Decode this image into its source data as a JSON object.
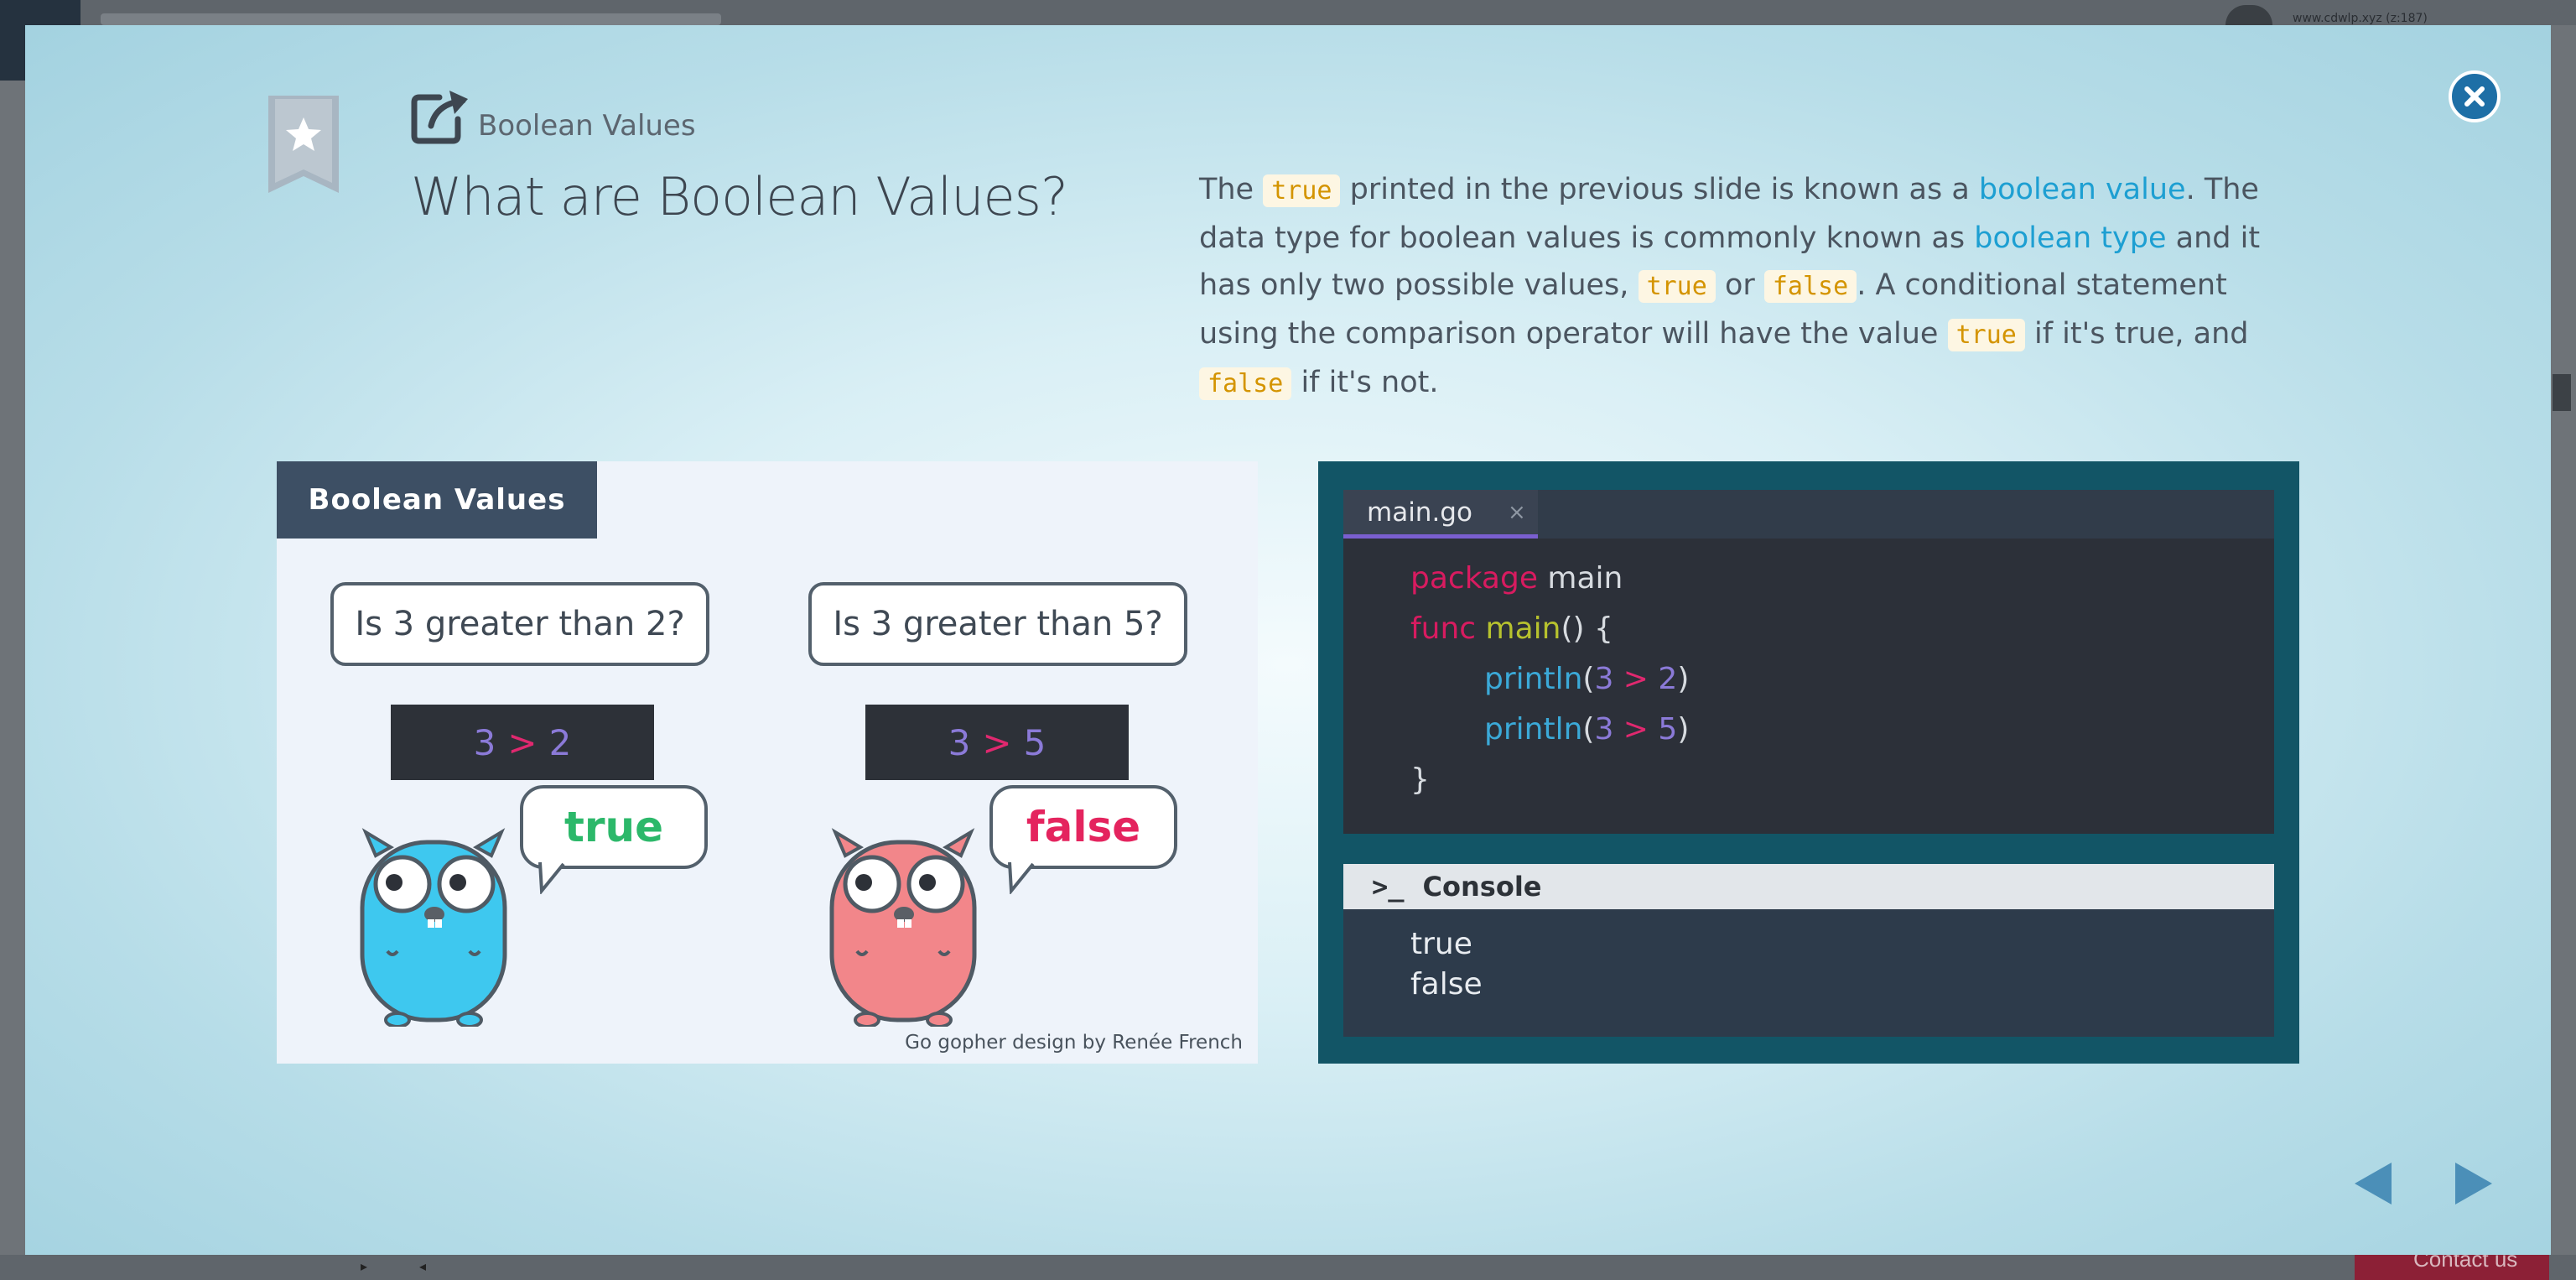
{
  "background": {
    "url_text": "www.cdwlp.xyz (z:187)",
    "contact_label": "Contact us"
  },
  "slide": {
    "section": "Boolean Values",
    "title": "What are Boolean Values?",
    "description": {
      "p1": "The ",
      "c1": "true",
      "p2": " printed in the previous slide is known as a ",
      "l1": "boolean value",
      "p3": ". The data type for boolean values is commonly known as ",
      "l2": "boolean type",
      "p4": " and it has only two possible values, ",
      "c2": "true",
      "p5": " or ",
      "c3": "false",
      "p6": ". A conditional statement using the comparison operator will have the value ",
      "c4": "true",
      "p7": " if it's true, and ",
      "c5": "false",
      "p8": " if it's not."
    }
  },
  "illustration": {
    "tab_label": "Boolean Values",
    "left": {
      "question": "Is 3 greater than 2?",
      "expr_a": "3",
      "expr_op": ">",
      "expr_b": "2",
      "answer": "true"
    },
    "right": {
      "question": "Is 3 greater than 5?",
      "expr_a": "3",
      "expr_op": ">",
      "expr_b": "5",
      "answer": "false"
    },
    "credit": "Go gopher design by Renée French"
  },
  "editor": {
    "tab_label": "main.go",
    "tab_close": "×",
    "code": {
      "l1_kw": "package",
      "l1_name": " main",
      "l2_kw": "func",
      "l2_fn": " main",
      "l2_rest": "() {",
      "l3_fn": "println",
      "l3_open": "(",
      "l3_a": "3",
      "l3_op": " > ",
      "l3_b": "2",
      "l3_close": ")",
      "l4_fn": "println",
      "l4_open": "(",
      "l4_a": "3",
      "l4_op": " > ",
      "l4_b": "5",
      "l4_close": ")",
      "l5": "}"
    }
  },
  "console": {
    "prompt_icon": ">_",
    "title": "Console",
    "output_line1": "true",
    "output_line2": "false"
  },
  "colors": {
    "accent_link": "#1d9fd2",
    "code_pill_text": "#d49400",
    "true_green": "#2cb86a",
    "false_pink": "#e4245e",
    "gopher_blue": "#3ec8ef",
    "gopher_pink": "#f2868a",
    "panel_teal": "#125566",
    "close_blue": "#1e6fa6"
  },
  "icons": {
    "close": "close-icon",
    "bookmark": "bookmark-star-icon",
    "external_link": "external-link-icon",
    "prev": "triangle-left-icon",
    "next": "triangle-right-icon",
    "console": "terminal-prompt-icon"
  }
}
